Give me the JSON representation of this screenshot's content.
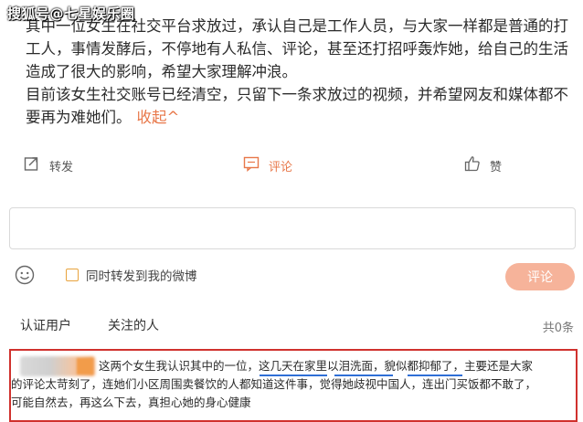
{
  "watermark": "搜狐号@七星娱乐圈",
  "post": {
    "para1": "其中一位女生在社交平台求放过，承认自己是工作人员，与大家一样都是普通的打工人，事情发酵后，不停地有人私信、评论，甚至还打招呼轰炸她，给自己的生活造成了很大的影响，希望大家理解冲浪。",
    "para2": "目前该女生社交账号已经清空，只留下一条求放过的视频，并希望网友和媒体都不要再为难她们。",
    "collapse_label": "收起^"
  },
  "actions": {
    "repost": "转发",
    "comment": "评论",
    "like": "赞"
  },
  "comment_input": {
    "placeholder": ""
  },
  "compose": {
    "repost_checkbox_label": "同时转发到我的微博",
    "submit_label": "评论"
  },
  "tabs": {
    "verified_users": "认证用户",
    "followed_people": "关注的人",
    "count": "共0条"
  },
  "highlighted_comment": {
    "line1": "这两个女生我认识其中的一位，这几天在家里以泪洗面，貌似都抑郁了，主要还是大家",
    "line2": "的评论太苛刻了，连她们小区周围卖餐饮的人都知道这件事，觉得她歧视中国人，连出门买饭都不敢了，",
    "line3": "可能自然去，再这么下去，真担心她的身心健康"
  },
  "colors": {
    "accent": "#e8784a",
    "button_bg": "#f6b39a",
    "highlight_border": "#d0312d",
    "underline": "#2f6fd6"
  }
}
